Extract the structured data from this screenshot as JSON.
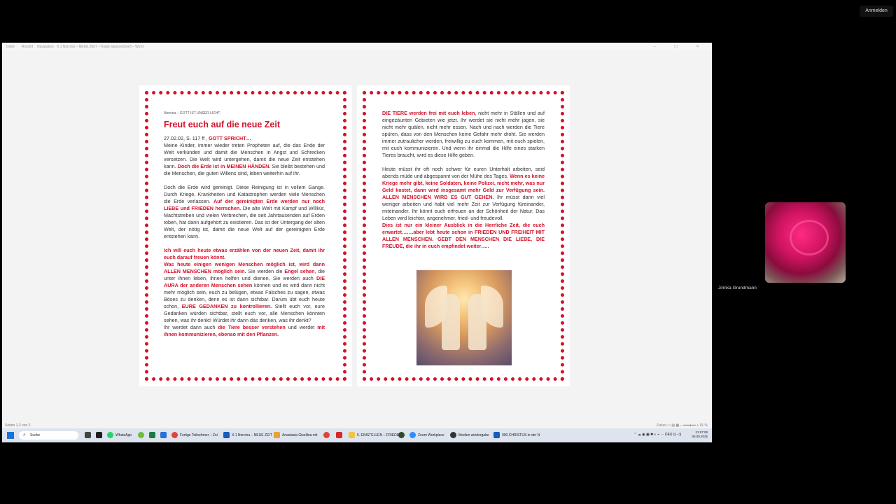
{
  "meeting": {
    "sign_in_label": "Anmelden",
    "participant_name": "Jirinka Grundmann"
  },
  "window": {
    "menu": [
      "Datei",
      "Ansicht",
      "Navigation"
    ],
    "title": "X.1 Norcina – NEUE ZEIT – Kopie (gespeichert) – Word"
  },
  "page1": {
    "header_note": "Norcina – GOTT IST UNSER LICHT",
    "title": "Freut euch auf die neue Zeit",
    "date_ref": "27.02.02, S. 117 ff , ",
    "speaker": "GOTT SPRICHT…",
    "p1_a": "Meine Kinder, immer wieder treten Propheten auf, die das Ende der Welt verkünden und damit die Menschen in Angst und Schrecken versetzen. Die Welt wird untergehen, damit die neue Zeit entstehen kann. ",
    "p1_b": "Doch die Erde ist in MEINEN HÄNDEN.",
    "p1_c": " Sie bleibt bestehen und die Menschen, die guten Willens sind, leben weiterhin auf ihr.",
    "p2_a": "Doch die Erde wird gereinigt. Diese Reinigung ist in vollem Gange. Durch Kriege, Krankheiten und Katastrophen werden viele Menschen die Erde verlassen. ",
    "p2_b": "Auf der gereinigten Erde werden nur noch LIEBE und FRIEDEN herrschen.",
    "p2_c": " Die alte Welt mit Kampf und Willkür, Machtstreben und vielen Verbrechen, die seit Jahrtausenden auf Erden toben, hat dann aufgehört zu existieren. Das ist der Untergang der alten Welt, der nötig ist, damit die neue Welt auf der gereinigten Erde entstehen kann.",
    "p3_a": "Ich will euch heute etwas erzählen von der neuen Zeit, damit ihr euch darauf freuen könnt.",
    "p3_b": "Was heute einigen wenigen Menschen möglich ist, wird dann ALLEN MENSCHEN möglich sein.",
    "p3_c": " Sie werden die ",
    "p3_d": "Engel sehen",
    "p3_e": ", die unter ihnen leben, ihnen helfen und dienen. Sie werden auch ",
    "p3_f": "DIE AURA der anderen Menschen sehen",
    "p3_g": " können und es wird dann nicht mehr möglich sein, euch zu belügen, etwas Falsches zu sagen, etwas Böses zu denken, denn es ist dann sichtbar. Darum übt euch heute schon, ",
    "p3_h": "EURE GEDANKEN zu kontrollieren.",
    "p3_i": " Stellt euch vor, eure Gedanken würden sichtbar, stellt euch vor, alle Menschen könnten sehen, was ihr denkt! Würdet ihr dann das denken, was ihr denkt?",
    "p3_j": "Ihr werdet dann auch ",
    "p3_k": "die Tiere besser verstehen",
    "p3_l": " und werdet ",
    "p3_m": "mit ihnen kommunizieren, ebenso mit den Pflanzen."
  },
  "page2": {
    "p1_a": "DIE TIERE werden frei mit euch leben",
    "p1_b": ", nicht mehr in Ställen und auf eingezäunten Gebieten wie jetzt. Ihr werdet sie nicht mehr jagen, sie nicht mehr quälen, nicht mehr essen. Nach und nach werden die Tiere spüren, dass von den Menschen keine Gefahr mehr droht. Sie werden immer zutraulicher werden, freiwillig zu euch kommen, mit euch spielen, mit euch kommunizieren. Und wenn ihr einmal die Hilfe eines starken Tieres braucht, wird es diese Hilfe geben.",
    "p2_a": "Heute müsst ihr oft noch schwer für euren Unterhalt arbeiten, seid abends müde und abgespannt von der Mühe des Tages. ",
    "p2_b": "Wenn es keine Kriege mehr gibt, keine Soldaten, keine Polizei, nicht mehr, was nur Geld kostet, dann wird insgesamt mehr Geld zur Verfügung sein. ALLEN MENSCHEN WIRD ES GUT GEHEN.",
    "p2_c": " Ihr müsst dann viel weniger arbeiten und habt viel mehr Zeit zur Verfügung füreinander, miteinander. Ihr könnt euch erfreuen an der Schönheit der Natur. Das Leben wird leichter, angenehmer, fried- und freudevoll.",
    "p3": "Dies ist nur ein kleiner Ausblick in die Herrliche Zeit, die euch erwartet…….aber lebt heute schon in FRIEDEN UND FREIHEIT MIT ALLEN MENSCHEN. GEBT DEN MENSCHEN DIE LIEBE, DIE FREUDE, die ihr in euch empfindet weiter….."
  },
  "statusbar": {
    "left": "Seiten 1-2 von 2",
    "focus": "Fokus",
    "zoom": "91 %"
  },
  "taskbar": {
    "search_placeholder": "Suche",
    "items": [
      "WhatsApp",
      "Fertige Teilnehmer – Zoi",
      "X.1 Norcina – NEUE ZEIT",
      "Anastasia Gisellina mit",
      "5. EINSTELLEN – FRIEDE",
      "Zoom Workplace",
      "Medien wiedergabe",
      "000.CHRISTUS in der N"
    ],
    "lang": "DEU",
    "time": "21:07:08",
    "date": "06.09.2025"
  }
}
